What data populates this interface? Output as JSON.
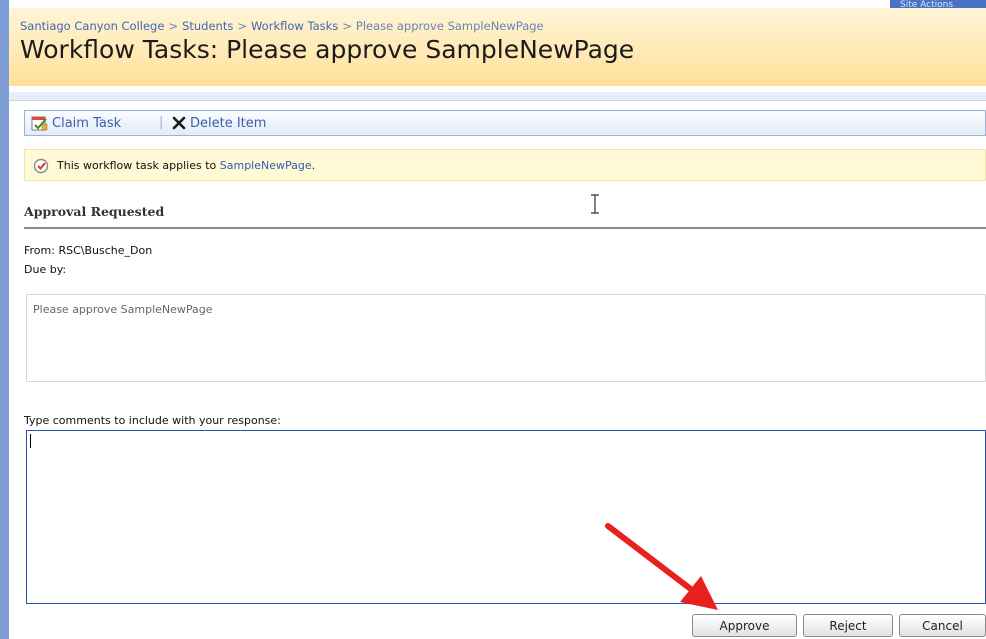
{
  "top_corner": {
    "label": "Site Actions"
  },
  "breadcrumb": {
    "items": [
      "Santiago Canyon College",
      "Students",
      "Workflow Tasks",
      "Please approve SampleNewPage"
    ],
    "separator": ">"
  },
  "page_title": "Workflow Tasks: Please approve SampleNewPage",
  "toolbar": {
    "claim_label": "Claim Task",
    "separator": "|",
    "delete_label": "Delete Item"
  },
  "info_bar": {
    "text": "This workflow task applies to ",
    "link": "SampleNewPage",
    "suffix": "."
  },
  "section": {
    "title": "Approval Requested"
  },
  "details": {
    "from": "From: RSC\\Busche_Don",
    "due_by": "Due by:"
  },
  "description": "Please approve SampleNewPage",
  "comments": {
    "label": "Type comments to include with your response:",
    "value": ""
  },
  "buttons": {
    "approve": "Approve",
    "reject": "Reject",
    "cancel": "Cancel"
  },
  "colors": {
    "header_top": "#fff5d8",
    "header_bottom": "#ffe09a",
    "link": "#2d5cb0",
    "arrow": "#e8211d",
    "accent_border": "#2c55a8"
  },
  "icons": [
    "claim-task-icon",
    "delete-icon",
    "workflow-icon",
    "arrow-annotation"
  ]
}
